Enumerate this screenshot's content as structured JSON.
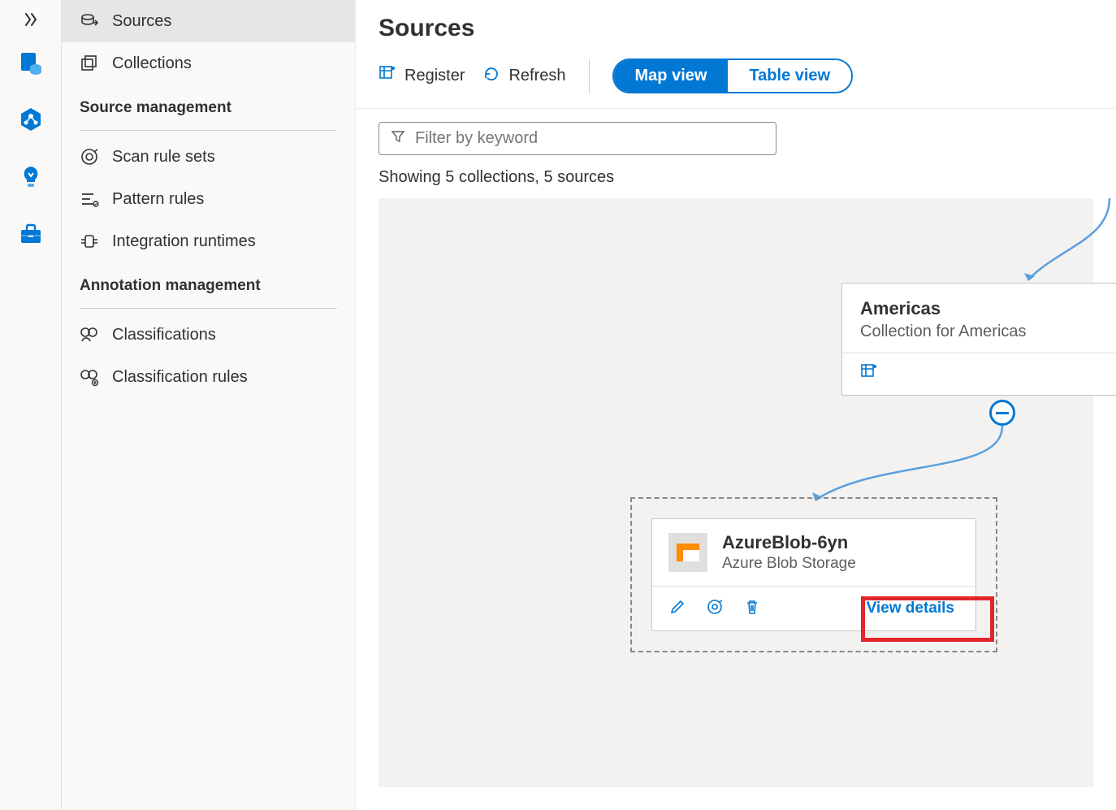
{
  "sidebar": {
    "items": [
      {
        "label": "Sources"
      },
      {
        "label": "Collections"
      }
    ],
    "sections": [
      {
        "title": "Source management",
        "items": [
          {
            "label": "Scan rule sets"
          },
          {
            "label": "Pattern rules"
          },
          {
            "label": "Integration runtimes"
          }
        ]
      },
      {
        "title": "Annotation management",
        "items": [
          {
            "label": "Classifications"
          },
          {
            "label": "Classification rules"
          }
        ]
      }
    ]
  },
  "page": {
    "title": "Sources"
  },
  "toolbar": {
    "register": "Register",
    "refresh": "Refresh",
    "map_view": "Map view",
    "table_view": "Table view"
  },
  "filter": {
    "placeholder": "Filter by keyword"
  },
  "status": {
    "text": "Showing 5 collections, 5 sources"
  },
  "collection": {
    "title": "Americas",
    "subtitle": "Collection for Americas"
  },
  "source": {
    "title": "AzureBlob-6yn",
    "subtitle": "Azure Blob Storage",
    "view_details": "View details"
  }
}
